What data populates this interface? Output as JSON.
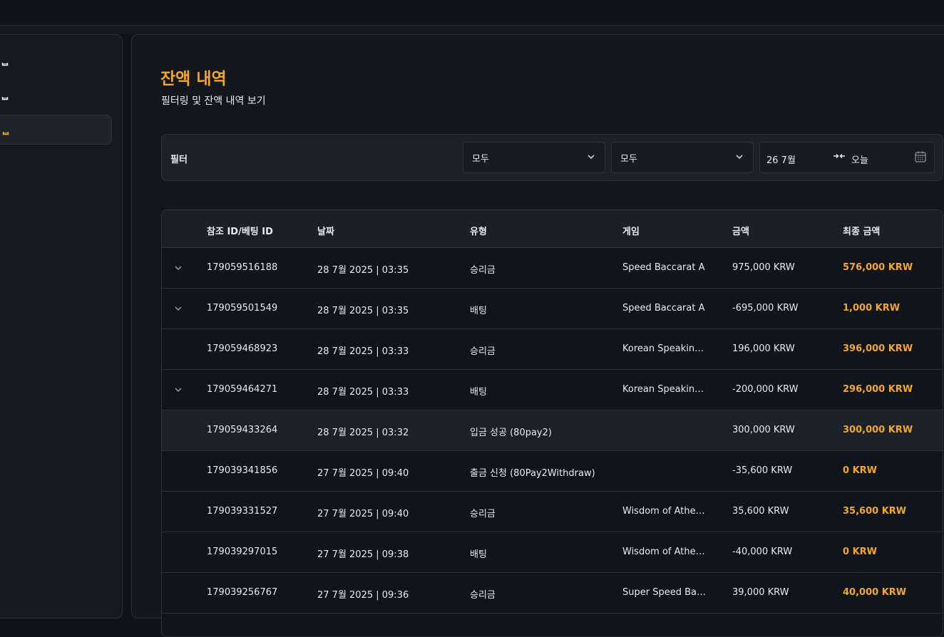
{
  "sidebar": {
    "items": [
      {
        "label": "ᆸ",
        "active": false
      },
      {
        "label": "ᆸ",
        "active": false
      },
      {
        "label": "ᆸ",
        "active": true
      }
    ]
  },
  "page": {
    "title": "잔액 내역",
    "subtitle": "필터링 및 잔액 내역 보기"
  },
  "filter": {
    "label": "필터",
    "select1_value": "모두",
    "select2_value": "모두",
    "date_from": "26 7월",
    "date_to": "오늘"
  },
  "table": {
    "headers": [
      "참조 ID/베팅 ID",
      "날짜",
      "유형",
      "게임",
      "금액",
      "최종 금액"
    ],
    "rows": [
      {
        "expandable": true,
        "id": "179059516188",
        "date": "28 7월 2025 | 03:35",
        "type": "승리금",
        "game": "Speed Baccarat A",
        "amount": "975,000 KRW",
        "final": "576,000 KRW",
        "highlight": false
      },
      {
        "expandable": true,
        "id": "179059501549",
        "date": "28 7월 2025 | 03:35",
        "type": "배팅",
        "game": "Speed Baccarat A",
        "amount": "-695,000 KRW",
        "final": "1,000 KRW",
        "highlight": false
      },
      {
        "expandable": false,
        "id": "179059468923",
        "date": "28 7월 2025 | 03:33",
        "type": "승리금",
        "game": "Korean Speakin…",
        "amount": "196,000 KRW",
        "final": "396,000 KRW",
        "highlight": false
      },
      {
        "expandable": true,
        "id": "179059464271",
        "date": "28 7월 2025 | 03:33",
        "type": "배팅",
        "game": "Korean Speakin…",
        "amount": "-200,000 KRW",
        "final": "296,000 KRW",
        "highlight": false
      },
      {
        "expandable": false,
        "id": "179059433264",
        "date": "28 7월 2025 | 03:32",
        "type": "입금 성공 (80pay2)",
        "game": "",
        "amount": "300,000 KRW",
        "final": "300,000 KRW",
        "highlight": true
      },
      {
        "expandable": false,
        "id": "179039341856",
        "date": "27 7월 2025 | 09:40",
        "type": "출금 신청 (80Pay2Withdraw)",
        "game": "",
        "amount": "-35,600 KRW",
        "final": "0 KRW",
        "highlight": false
      },
      {
        "expandable": false,
        "id": "179039331527",
        "date": "27 7월 2025 | 09:40",
        "type": "승리금",
        "game": "Wisdom of Athe…",
        "amount": "35,600 KRW",
        "final": "35,600 KRW",
        "highlight": false
      },
      {
        "expandable": false,
        "id": "179039297015",
        "date": "27 7월 2025 | 09:38",
        "type": "배팅",
        "game": "Wisdom of Athe…",
        "amount": "-40,000 KRW",
        "final": "0 KRW",
        "highlight": false
      },
      {
        "expandable": false,
        "id": "179039256767",
        "date": "27 7월 2025 | 09:36",
        "type": "승리금",
        "game": "Super Speed Ba…",
        "amount": "39,000 KRW",
        "final": "40,000 KRW",
        "highlight": false
      }
    ]
  },
  "colors": {
    "accent": "#f5a623",
    "background": "#0e141b",
    "panel": "#1b2128"
  }
}
